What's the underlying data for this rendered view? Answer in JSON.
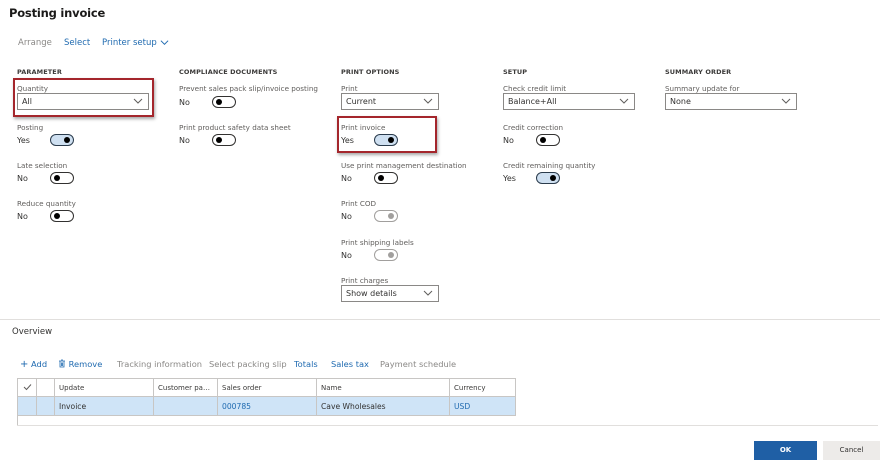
{
  "title": "Posting invoice",
  "toolbar": {
    "arrange": "Arrange",
    "select": "Select",
    "printer_setup": "Printer setup"
  },
  "parameter": {
    "header": "PARAMETER",
    "quantity_label": "Quantity",
    "quantity_value": "All",
    "posting_label": "Posting",
    "posting_value": "Yes",
    "late_selection_label": "Late selection",
    "late_selection_value": "No",
    "reduce_quantity_label": "Reduce quantity",
    "reduce_quantity_value": "No"
  },
  "compliance": {
    "header": "COMPLIANCE DOCUMENTS",
    "prevent_label": "Prevent sales pack slip/invoice posting",
    "prevent_value": "No",
    "safety_label": "Print product safety data sheet",
    "safety_value": "No"
  },
  "print_options": {
    "header": "PRINT OPTIONS",
    "print_label": "Print",
    "print_value": "Current",
    "print_invoice_label": "Print invoice",
    "print_invoice_value": "Yes",
    "use_pm_label": "Use print management destination",
    "use_pm_value": "No",
    "cod_label": "Print COD",
    "cod_value": "No",
    "shipping_label": "Print shipping labels",
    "shipping_value": "No",
    "charges_label": "Print charges",
    "charges_value": "Show details"
  },
  "setup": {
    "header": "SETUP",
    "credit_limit_label": "Check credit limit",
    "credit_limit_value": "Balance+All",
    "credit_correction_label": "Credit correction",
    "credit_correction_value": "No",
    "credit_remaining_label": "Credit remaining quantity",
    "credit_remaining_value": "Yes"
  },
  "summary_order": {
    "header": "SUMMARY ORDER",
    "update_for_label": "Summary update for",
    "update_for_value": "None"
  },
  "overview": {
    "title": "Overview",
    "actions": {
      "add": "Add",
      "remove": "Remove",
      "tracking": "Tracking information",
      "packing": "Select packing slip",
      "totals": "Totals",
      "sales_tax": "Sales tax",
      "payment": "Payment schedule"
    },
    "columns": [
      "Update",
      "Customer packi...",
      "Sales order",
      "Name",
      "Currency"
    ],
    "rows": [
      {
        "update": "Invoice",
        "customer_packing": "",
        "sales_order": "000785",
        "name": "Cave Wholesales",
        "currency": "USD"
      }
    ]
  },
  "footer": {
    "ok": "OK",
    "cancel": "Cancel"
  },
  "colors": {
    "accent": "#1f5fa5",
    "highlight_border": "#a4262c",
    "selected_row": "#cfe4f7"
  }
}
